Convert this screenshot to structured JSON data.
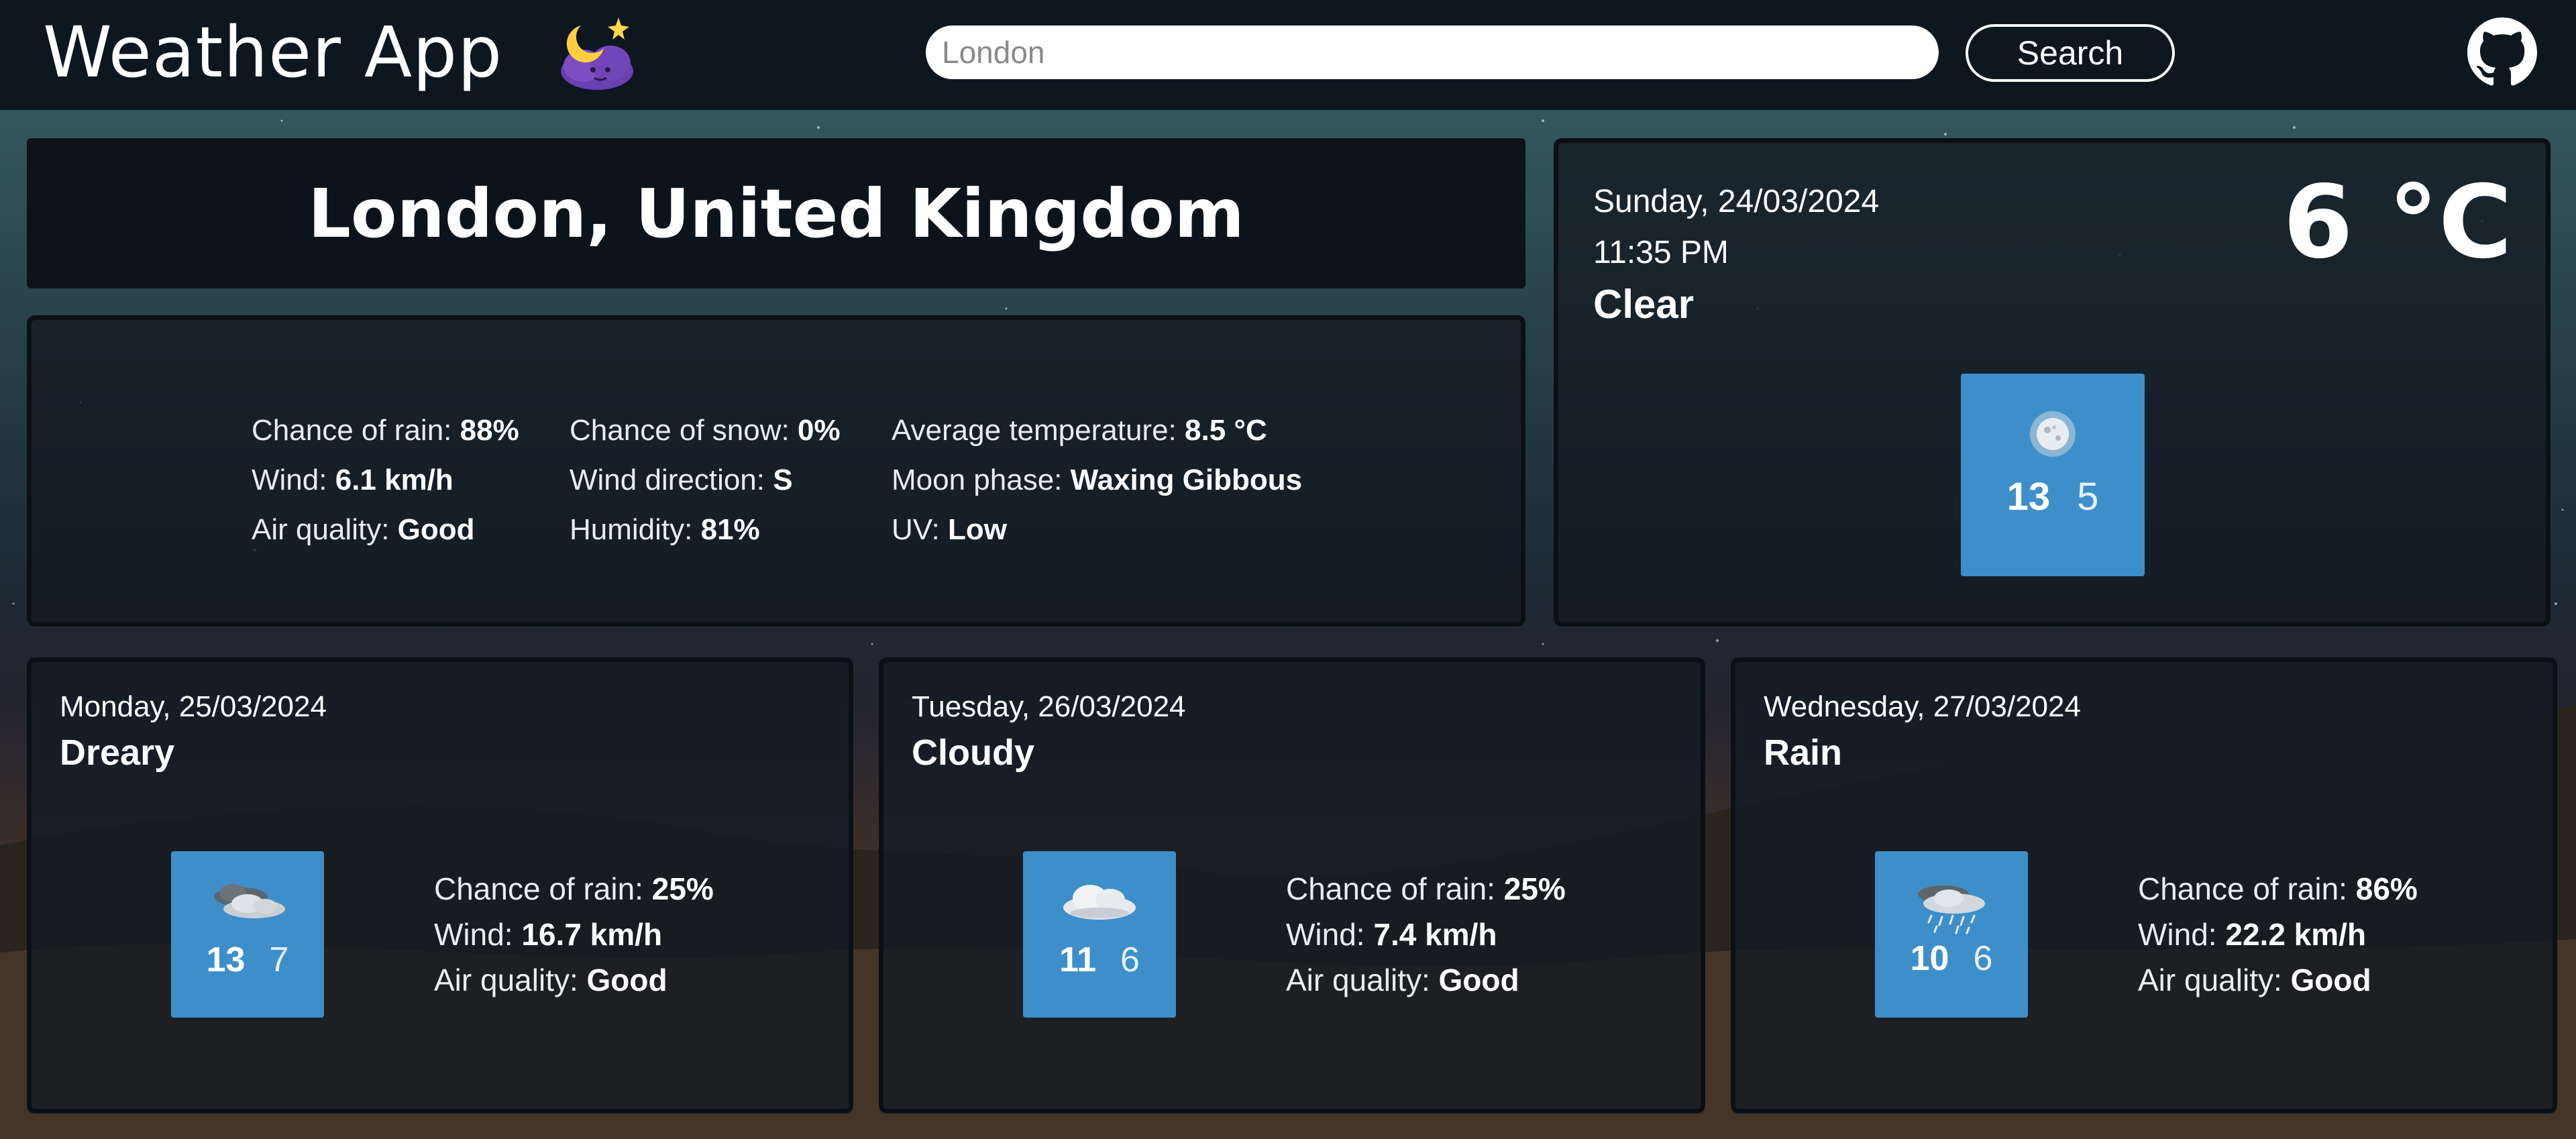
{
  "header": {
    "title": "Weather App",
    "search_placeholder": "London",
    "search_label": "Search"
  },
  "location": {
    "name": "London, United Kingdom"
  },
  "details": {
    "chance_of_rain": {
      "label": "Chance of rain:",
      "value": "88%"
    },
    "wind": {
      "label": "Wind:",
      "value": "6.1 km/h"
    },
    "air_quality": {
      "label": "Air quality:",
      "value": "Good"
    },
    "chance_of_snow": {
      "label": "Chance of snow:",
      "value": "0%"
    },
    "wind_direction": {
      "label": "Wind direction:",
      "value": "S"
    },
    "humidity": {
      "label": "Humidity:",
      "value": "81%"
    },
    "average_temperature": {
      "label": "Average temperature:",
      "value": "8.5 °C"
    },
    "moon_phase": {
      "label": "Moon phase:",
      "value": "Waxing Gibbous"
    },
    "uv": {
      "label": "UV:",
      "value": "Low"
    }
  },
  "current": {
    "date": "Sunday, 24/03/2024",
    "time": "11:35 PM",
    "condition": "Clear",
    "temperature": "6 °C",
    "icon": "moon-clear-icon",
    "high": "13",
    "low": "5"
  },
  "forecast": [
    {
      "date": "Monday, 25/03/2024",
      "condition": "Dreary",
      "icon": "dark-cloud-icon",
      "high": "13",
      "low": "7",
      "chance_of_rain": {
        "label": "Chance of rain:",
        "value": "25%"
      },
      "wind": {
        "label": "Wind:",
        "value": "16.7 km/h"
      },
      "air_quality": {
        "label": "Air quality:",
        "value": "Good"
      }
    },
    {
      "date": "Tuesday, 26/03/2024",
      "condition": "Cloudy",
      "icon": "cloud-icon",
      "high": "11",
      "low": "6",
      "chance_of_rain": {
        "label": "Chance of rain:",
        "value": "25%"
      },
      "wind": {
        "label": "Wind:",
        "value": "7.4 km/h"
      },
      "air_quality": {
        "label": "Air quality:",
        "value": "Good"
      }
    },
    {
      "date": "Wednesday, 27/03/2024",
      "condition": "Rain",
      "icon": "rain-cloud-icon",
      "high": "10",
      "low": "6",
      "chance_of_rain": {
        "label": "Chance of rain:",
        "value": "86%"
      },
      "wind": {
        "label": "Wind:",
        "value": "22.2 km/h"
      },
      "air_quality": {
        "label": "Air quality:",
        "value": "Good"
      }
    }
  ],
  "colors": {
    "header_bg": "#0e1620",
    "panel_bg": "#131a22",
    "tile_blue": "#3e8fc9",
    "text": "#ffffff"
  }
}
